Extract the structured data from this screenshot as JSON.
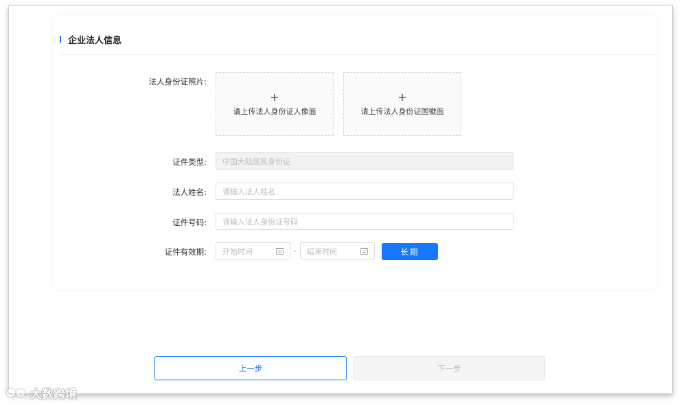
{
  "section": {
    "title": "企业法人信息",
    "accent_color": "#1677ff"
  },
  "upload": {
    "label": "法人身份证照片:",
    "front_text": "请上传法人身份证人像面",
    "back_text": "请上传法人身份证国徽面",
    "plus_icon": "+"
  },
  "id_type": {
    "label": "证件类型:",
    "value": "中国大陆居民身份证"
  },
  "legal_name": {
    "label": "法人姓名:",
    "placeholder": "请输入法人姓名"
  },
  "id_number": {
    "label": "证件号码:",
    "placeholder": "请输入法人身份证号码"
  },
  "validity": {
    "label": "证件有效期:",
    "start_placeholder": "开始时间",
    "end_placeholder": "结束时间",
    "separator": "-",
    "long_term_button": "长期",
    "icon": "calendar-icon"
  },
  "footer": {
    "prev_button": "上一步",
    "next_button": "下一步"
  },
  "watermark": {
    "text": "大数跨境"
  }
}
